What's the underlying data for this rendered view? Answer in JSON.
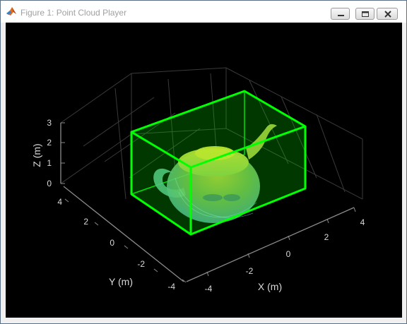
{
  "window": {
    "title": "Figure 1: Point Cloud Player",
    "icon": "matlab-logo-icon",
    "buttons": {
      "minimize": "minimize-icon",
      "maximize": "maximize-icon",
      "close": "close-icon"
    }
  },
  "plot": {
    "background": "#000000",
    "point_color": "#5ee04a",
    "box_color": "#00ff00",
    "axes_color": "#8a8a8a",
    "grid": true,
    "xlabel": "X (m)",
    "ylabel": "Y (m)",
    "zlabel": "Z (m)",
    "x_ticks": [
      "-4",
      "-2",
      "0",
      "2",
      "4"
    ],
    "y_ticks": [
      "-4",
      "-2",
      "0",
      "2",
      "4"
    ],
    "z_ticks": [
      "0",
      "1",
      "2",
      "3"
    ]
  }
}
